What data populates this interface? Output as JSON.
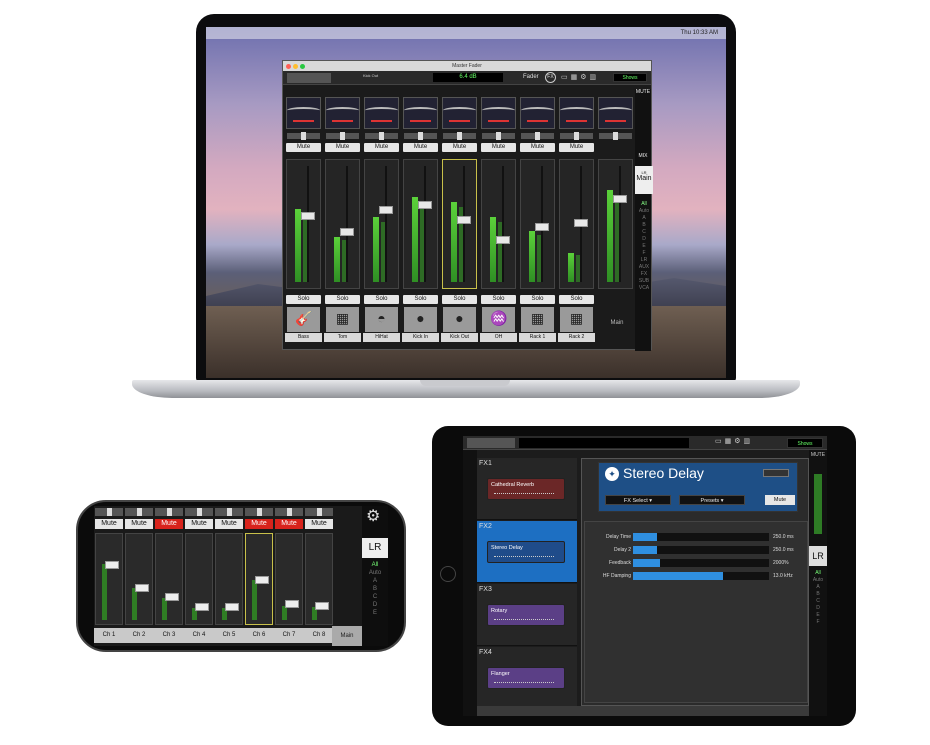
{
  "laptop": {
    "menubar_time": "Thu 10:33 AM",
    "window_title": "Master Fader",
    "toolbar": {
      "channel_name": "Kick Out",
      "db_readout": "6.4 dB",
      "fader_label": "Fader",
      "fx_label": "FX",
      "shows_label": "Shows"
    },
    "channels": [
      {
        "name": "Bass",
        "mute": "Mute",
        "solo": "Solo",
        "icon": "guitar-icon",
        "glyph": "🎸",
        "meter": 0.62,
        "level": 0.58,
        "selected": false
      },
      {
        "name": "Tom",
        "mute": "Mute",
        "solo": "Solo",
        "icon": "drum-icon",
        "glyph": "▦",
        "meter": 0.38,
        "level": 0.44,
        "selected": false
      },
      {
        "name": "HiHat",
        "mute": "Mute",
        "solo": "Solo",
        "icon": "hihat-icon",
        "glyph": "◓",
        "meter": 0.55,
        "level": 0.64,
        "selected": false
      },
      {
        "name": "Kick In",
        "mute": "Mute",
        "solo": "Solo",
        "icon": "kick-icon",
        "glyph": "●",
        "meter": 0.72,
        "level": 0.68,
        "selected": false
      },
      {
        "name": "Kick Out",
        "mute": "Mute",
        "solo": "Solo",
        "icon": "kick-icon",
        "glyph": "●",
        "meter": 0.68,
        "level": 0.55,
        "selected": true
      },
      {
        "name": "OH",
        "mute": "Mute",
        "solo": "Solo",
        "icon": "cymbal-icon",
        "glyph": "♒",
        "meter": 0.55,
        "level": 0.36,
        "selected": false
      },
      {
        "name": "Rack 1",
        "mute": "Mute",
        "solo": "Solo",
        "icon": "drum-icon",
        "glyph": "▦",
        "meter": 0.43,
        "level": 0.48,
        "selected": false
      },
      {
        "name": "Rack 2",
        "mute": "Mute",
        "solo": "Solo",
        "icon": "drum-icon",
        "glyph": "▦",
        "meter": 0.25,
        "level": 0.52,
        "selected": false
      },
      {
        "name": "Main",
        "mute": "",
        "solo": "",
        "icon": "",
        "glyph": "",
        "meter": 0.78,
        "level": 0.74,
        "selected": false
      }
    ],
    "side": {
      "mute": "MUTE",
      "mix": "MIX",
      "main": "Main",
      "lr": "LR",
      "items": [
        "All",
        "Auto",
        "A",
        "B",
        "C",
        "D",
        "E",
        "F",
        "LR",
        "AUX",
        "FX",
        "SUB",
        "VCA"
      ],
      "master": "Main"
    }
  },
  "phone": {
    "channels": [
      {
        "name": "Ch 1",
        "mute": "Mute",
        "muted": false,
        "level": 0.7,
        "selected": false
      },
      {
        "name": "Ch 2",
        "mute": "Mute",
        "muted": false,
        "level": 0.4,
        "selected": false
      },
      {
        "name": "Ch 3",
        "mute": "Mute",
        "muted": true,
        "level": 0.28,
        "selected": false
      },
      {
        "name": "Ch 4",
        "mute": "Mute",
        "muted": false,
        "level": 0.15,
        "selected": false
      },
      {
        "name": "Ch 5",
        "mute": "Mute",
        "muted": false,
        "level": 0.15,
        "selected": false
      },
      {
        "name": "Ch 6",
        "mute": "Mute",
        "muted": true,
        "level": 0.5,
        "selected": true
      },
      {
        "name": "Ch 7",
        "mute": "Mute",
        "muted": true,
        "level": 0.18,
        "selected": false
      },
      {
        "name": "Ch 8",
        "mute": "Mute",
        "muted": false,
        "level": 0.16,
        "selected": false
      }
    ],
    "lr": "LR",
    "list": [
      "All",
      "Auto",
      "A",
      "B",
      "C",
      "D",
      "E"
    ],
    "main": "Main"
  },
  "tablet": {
    "shows_label": "Shows",
    "fx": [
      {
        "label": "FX1",
        "preset": "Cathedral Reverb",
        "color": "red"
      },
      {
        "label": "FX2",
        "preset": "Stereo Delay",
        "color": "blue",
        "selected": true
      },
      {
        "label": "FX3",
        "preset": "Rotary",
        "color": "purple"
      },
      {
        "label": "FX4",
        "preset": "Flanger",
        "color": "purple"
      }
    ],
    "plugin": {
      "title": "Stereo Delay",
      "fx_select": "FX Select ▾",
      "presets": "Presets ▾",
      "mute": "Mute",
      "params": [
        {
          "label": "Delay Time",
          "value": "250.0 ms",
          "fill": 0.18
        },
        {
          "label": "Delay 2",
          "value": "250.0 ms",
          "fill": 0.18
        },
        {
          "label": "Feedback",
          "value": "2000%",
          "fill": 0.2
        },
        {
          "label": "HF Damping",
          "value": "13.0 kHz",
          "fill": 0.66
        }
      ]
    },
    "side": {
      "mute": "MUTE",
      "lr": "LR",
      "items": [
        "All",
        "Auto",
        "A",
        "B",
        "C",
        "D",
        "E",
        "F"
      ]
    }
  },
  "colors": {
    "mute_active": "#d8231c",
    "meter_green": "#4fc33a",
    "selection_blue": "#1d6fc2"
  }
}
